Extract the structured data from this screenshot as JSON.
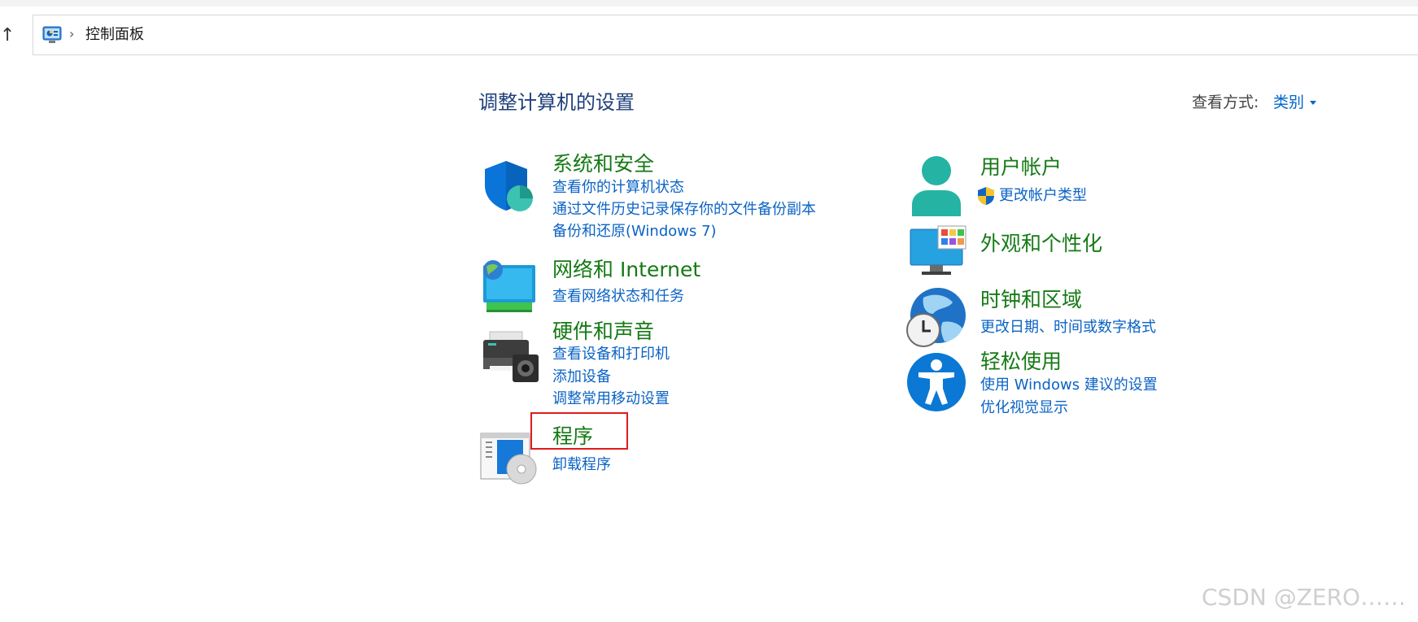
{
  "addressbar": {
    "up_icon": "arrow-up-icon",
    "location_icon": "control-panel-icon",
    "separator": "›",
    "path": "控制面板"
  },
  "header": {
    "title": "调整计算机的设置",
    "view_by_label": "查看方式:",
    "view_by_value": "类别"
  },
  "categories": {
    "system_security": {
      "icon": "shield-icon",
      "title": "系统和安全",
      "links": [
        "查看你的计算机状态",
        "通过文件历史记录保存你的文件备份副本",
        "备份和还原(Windows 7)"
      ]
    },
    "network": {
      "icon": "network-icon",
      "title": "网络和 Internet",
      "links": [
        "查看网络状态和任务"
      ]
    },
    "hardware": {
      "icon": "printer-icon",
      "title": "硬件和声音",
      "links": [
        "查看设备和打印机",
        "添加设备",
        "调整常用移动设置"
      ]
    },
    "programs": {
      "icon": "programs-icon",
      "title": "程序",
      "links": [
        "卸载程序"
      ]
    },
    "user_accounts": {
      "icon": "user-icon",
      "title": "用户帐户",
      "links": [
        "更改帐户类型"
      ]
    },
    "appearance": {
      "icon": "monitor-icon",
      "title": "外观和个性化",
      "links": []
    },
    "clock_region": {
      "icon": "globe-clock-icon",
      "title": "时钟和区域",
      "links": [
        "更改日期、时间或数字格式"
      ]
    },
    "ease_of_access": {
      "icon": "accessibility-icon",
      "title": "轻松使用",
      "links": [
        "使用 Windows 建议的设置",
        "优化视觉显示"
      ]
    }
  },
  "watermark": "CSDN @ZERO……",
  "colors": {
    "category_title": "#157a15",
    "link": "#0b63c5",
    "page_title": "#1e3f7a",
    "highlight": "#e01b1b"
  }
}
